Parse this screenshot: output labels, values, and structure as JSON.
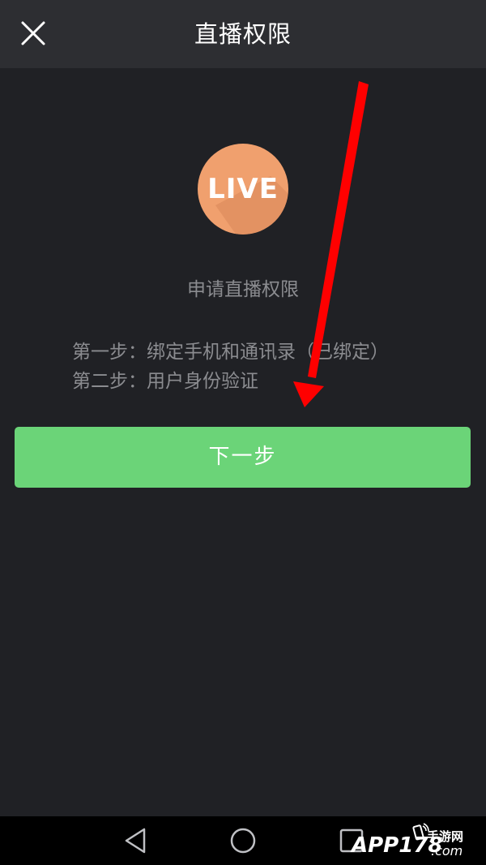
{
  "header": {
    "title": "直播权限",
    "close_icon": "close-icon"
  },
  "badge": {
    "text": "LIVE",
    "color": "#f0a06e",
    "shadow_color": "#d9865a"
  },
  "main": {
    "apply_title": "申请直播权限",
    "steps": [
      "第一步：绑定手机和通讯录（已绑定）",
      "第二步：用户身份验证"
    ],
    "next_button": "下一步"
  },
  "colors": {
    "background": "#202125",
    "topbar": "#2d2e32",
    "accent_green": "#6bd478",
    "muted_text": "#8b8c90",
    "annotation_arrow": "#ff0000"
  },
  "navbar": {
    "icons": [
      "back-icon",
      "home-icon",
      "recents-icon"
    ]
  },
  "watermark": {
    "logo": "APP178",
    "cn": "手游网",
    "com": ".com"
  }
}
